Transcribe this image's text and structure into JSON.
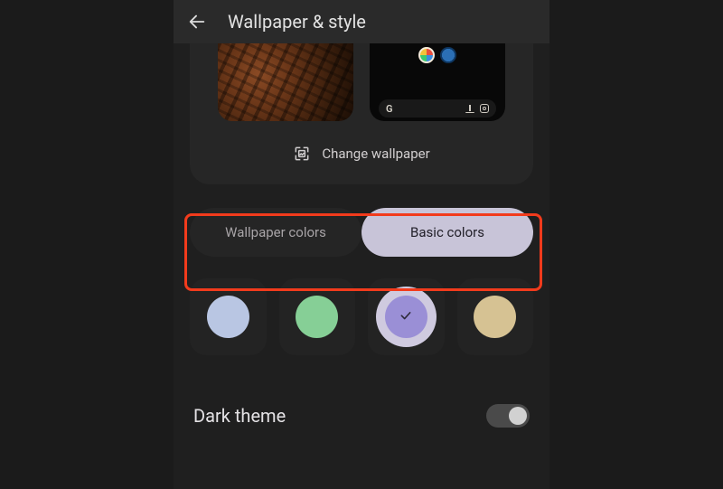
{
  "appbar": {
    "title": "Wallpaper & style"
  },
  "change_wallpaper_label": "Change wallpaper",
  "tabs": {
    "wallpaper_colors": "Wallpaper colors",
    "basic_colors": "Basic colors",
    "active": "basic_colors"
  },
  "swatches": [
    {
      "color": "#b9c6e3",
      "selected": false
    },
    {
      "color": "#86cf96",
      "selected": false
    },
    {
      "color": "#9a8fd6",
      "selected": true
    },
    {
      "color": "#d6c293",
      "selected": false
    }
  ],
  "dark_theme": {
    "label": "Dark theme",
    "enabled": true
  },
  "highlight": {
    "target": "color-source-tabs"
  }
}
